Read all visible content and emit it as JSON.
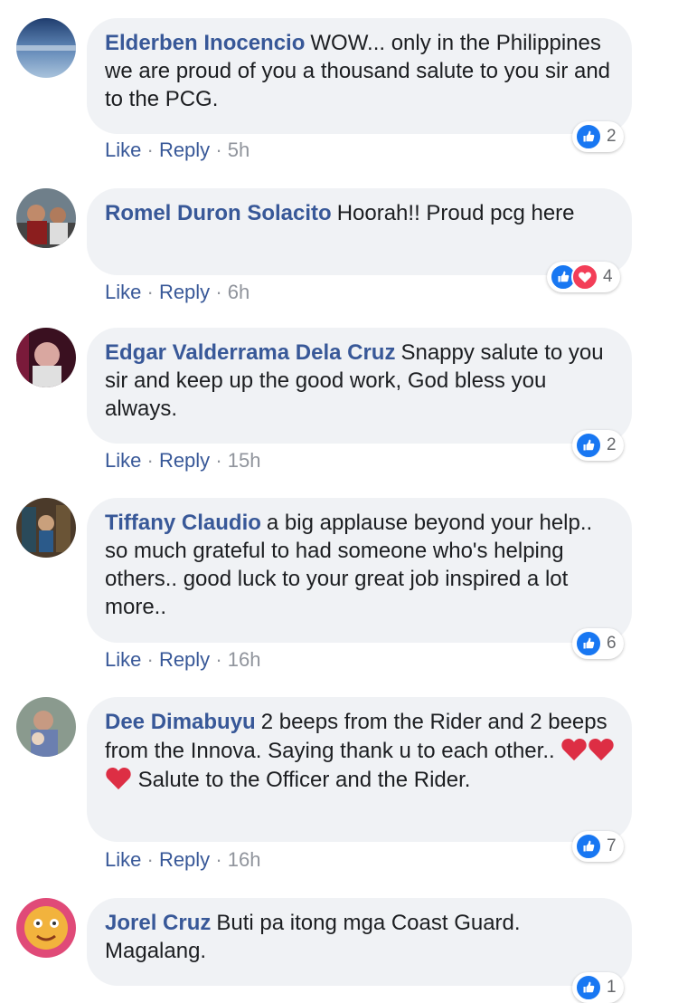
{
  "comments": [
    {
      "author": "Elderben Inocencio",
      "text": "WOW... only in the Philippines we are proud of you a thousand salute to you sir and to the PCG.",
      "like_label": "Like",
      "reply_label": "Reply",
      "time": "5h",
      "reaction_count": "2"
    },
    {
      "author": "Romel Duron Solacito",
      "text": "Hoorah!! Proud pcg here",
      "like_label": "Like",
      "reply_label": "Reply",
      "time": "6h",
      "reaction_count": "4"
    },
    {
      "author": "Edgar Valderrama Dela Cruz",
      "text": "Snappy salute to you sir and keep up the good work, God bless you always.",
      "like_label": "Like",
      "reply_label": "Reply",
      "time": "15h",
      "reaction_count": "2"
    },
    {
      "author": "Tiffany Claudio",
      "text": "a big applause beyond your help.. so much grateful to had someone who's helping others.. good luck to your great job inspired a lot more..",
      "like_label": "Like",
      "reply_label": "Reply",
      "time": "16h",
      "reaction_count": "6"
    },
    {
      "author": "Dee Dimabuyu",
      "text_before": "2 beeps from the Rider and 2 beeps from the Innova. Saying thank u to each other..",
      "text_after": "Salute to the Officer and the Rider.",
      "like_label": "Like",
      "reply_label": "Reply",
      "time": "16h",
      "reaction_count": "7"
    },
    {
      "author": "Jorel Cruz",
      "text": "Buti pa itong mga Coast Guard. Magalang.",
      "reaction_count": "1"
    }
  ],
  "separator": "·",
  "icons": {
    "like": "thumbs-up-icon",
    "love": "heart-icon",
    "emoji": "red-heart-emoji"
  },
  "colors": {
    "author": "#385898",
    "bubble": "#f0f2f5",
    "like": "#1877f2",
    "love": "#f33e58"
  }
}
